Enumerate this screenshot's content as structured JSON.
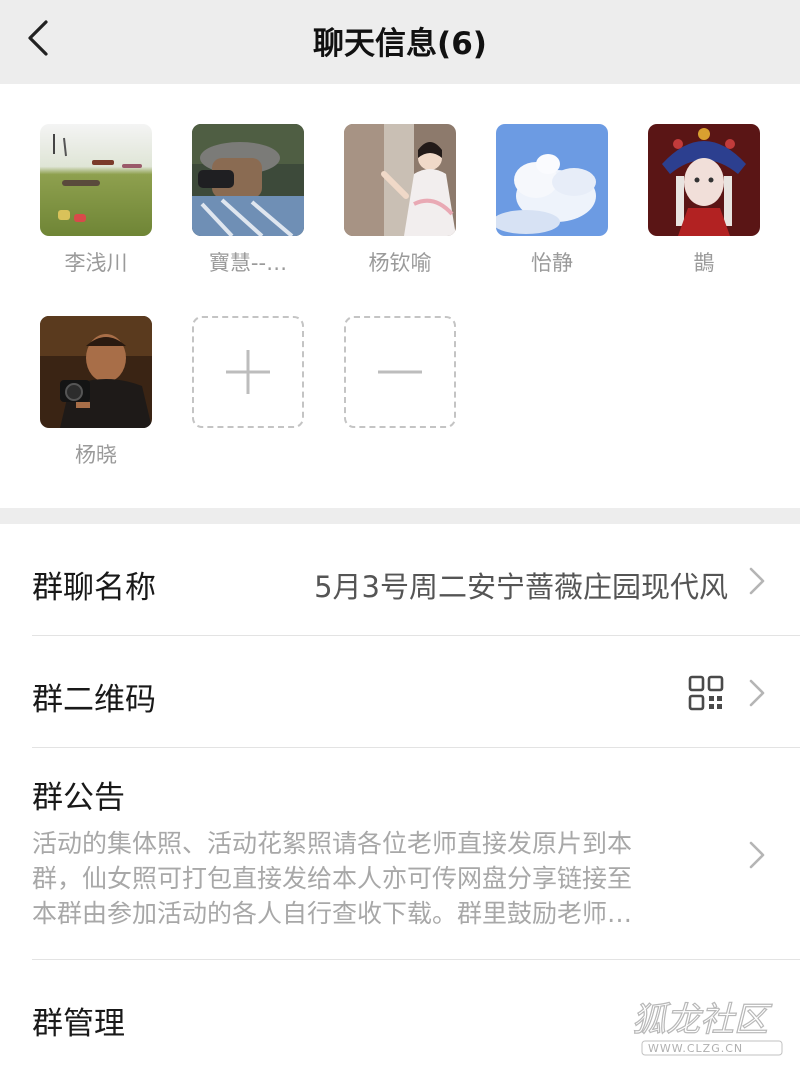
{
  "header": {
    "title": "聊天信息(6)",
    "back_icon": "chevron-left-icon"
  },
  "members": [
    {
      "name": "李浅川",
      "avatar": "grassland-photo"
    },
    {
      "name": "寶慧--…",
      "avatar": "man-with-cap-photo"
    },
    {
      "name": "杨钦喻",
      "avatar": "hanfu-girl-photo"
    },
    {
      "name": "怡静",
      "avatar": "sky-clouds-photo"
    },
    {
      "name": "鵲",
      "avatar": "ornate-headdress-art"
    },
    {
      "name": "杨晓",
      "avatar": "photographer-photo"
    }
  ],
  "member_actions": {
    "add_icon": "plus-icon",
    "remove_icon": "minus-icon"
  },
  "settings": {
    "group_name": {
      "label": "群聊名称",
      "value": "5月3号周二安宁蔷薇庄园现代风"
    },
    "qr_code": {
      "label": "群二维码",
      "icon": "qr-code-icon"
    },
    "notice": {
      "label": "群公告",
      "lines": [
        "活动的集体照、活动花絮照请各位老师直接发原片到本",
        "群，仙女照可打包直接发给本人亦可传网盘分享链接至",
        "本群由参加活动的各人自行查收下载。群里鼓励老师…"
      ]
    },
    "manage": {
      "label": "群管理"
    }
  },
  "watermark": {
    "text": "狐龙社区",
    "url_text": "WWW.CLZG.CN"
  },
  "colors": {
    "topbar_bg": "#ededed",
    "section_gap": "#ededed",
    "secondary_text": "#a8a8a8"
  }
}
